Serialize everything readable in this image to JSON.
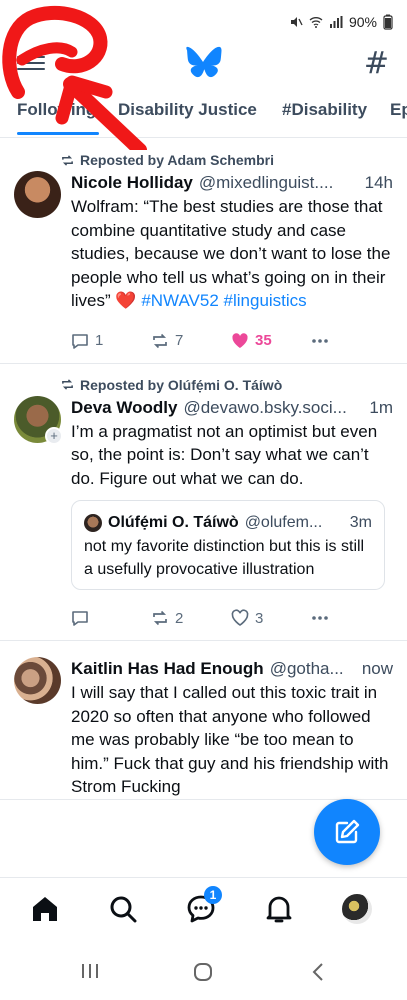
{
  "status_bar": {
    "time": "",
    "battery": "90%"
  },
  "colors": {
    "accent": "#1185fe",
    "like": "#ec4899",
    "annotation": "#f01818"
  },
  "header": {
    "menu_icon": "hamburger-menu-icon",
    "logo": "bluesky-butterfly-logo",
    "feeds_icon": "hashtag-icon"
  },
  "tabs": [
    {
      "label": "Following",
      "active": true
    },
    {
      "label": "Disability Justice",
      "active": false
    },
    {
      "label": "#Disability",
      "active": false
    },
    {
      "label": "Ep",
      "active": false
    }
  ],
  "posts": [
    {
      "reposted_by": "Reposted by Adam Schembri",
      "name": "Nicole Holliday",
      "handle": "@mixedlinguist....",
      "time": "14h",
      "text_main": "Wolfram: “The best studies are those that combine quantitative study and case studies, because we don’t want to lose the people who tell us what’s going on in their lives” ",
      "emoji": "❤️",
      "tags": [
        "#NWAV52",
        "#linguistics"
      ],
      "replies": "1",
      "reposts": "7",
      "likes": "35",
      "liked": true
    },
    {
      "reposted_by": "Reposted by Olúfẹ́mi O. Táíwò",
      "name": "Deva Woodly",
      "handle": "@devawo.bsky.soci...",
      "time": "1m",
      "text_main": "I’m a pragmatist not an optimist but even so, the point is: Don’t say what we can’t do. Figure out what we can do.",
      "quote": {
        "name": "Olúfẹ́mi O. Táíwò",
        "handle": "@olufem...",
        "time": "3m",
        "text": "not my favorite distinction but this is still a usefully provocative illustration"
      },
      "replies": "",
      "reposts": "2",
      "likes": "3",
      "liked": false
    },
    {
      "name": "Kaitlin Has Had Enough",
      "handle": "@gotha...",
      "time": "now",
      "text_main": "I will say that I called out this toxic trait in 2020 so often that anyone who followed me was probably like “be too mean to him.” Fuck that guy and his friendship with Strom Fucking"
    }
  ],
  "compose_icon": "compose-pencil-icon",
  "bottom_nav": [
    {
      "icon": "home-icon"
    },
    {
      "icon": "search-icon"
    },
    {
      "icon": "chat-icon",
      "badge": "1"
    },
    {
      "icon": "bell-icon"
    },
    {
      "icon": "profile-avatar"
    }
  ],
  "system_nav": [
    "recents-icon",
    "home-circle-icon",
    "back-icon"
  ]
}
